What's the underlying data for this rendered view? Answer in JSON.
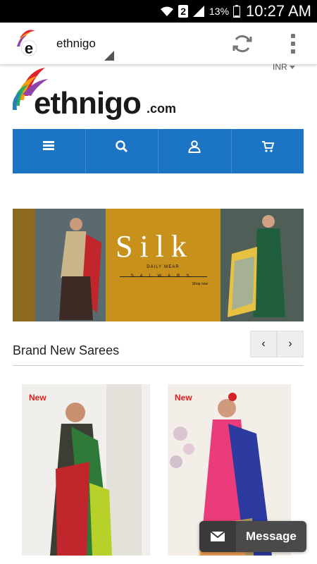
{
  "status_bar": {
    "sim_slot": "2",
    "battery": "13%",
    "time": "10:27 AM"
  },
  "app_bar": {
    "title": "ethnigo"
  },
  "site": {
    "currency": "INR",
    "logo_text": "ethnigo",
    "logo_suffix": ".com"
  },
  "banner": {
    "headline": "Silk",
    "subline": "DAILY WEAR",
    "tagline": "SALWARS",
    "cta": "Shop now"
  },
  "section": {
    "title": "Brand New Sarees"
  },
  "carousel": {
    "prev": "‹",
    "next": "›"
  },
  "products": [
    {
      "badge": "New"
    },
    {
      "badge": "New"
    }
  ],
  "message_button": {
    "label": "Message"
  },
  "icons": [
    "wifi-icon",
    "signal-icon",
    "battery-icon",
    "refresh-icon",
    "overflow-menu-icon",
    "menu-icon",
    "search-icon",
    "user-icon",
    "cart-icon",
    "mail-icon"
  ]
}
